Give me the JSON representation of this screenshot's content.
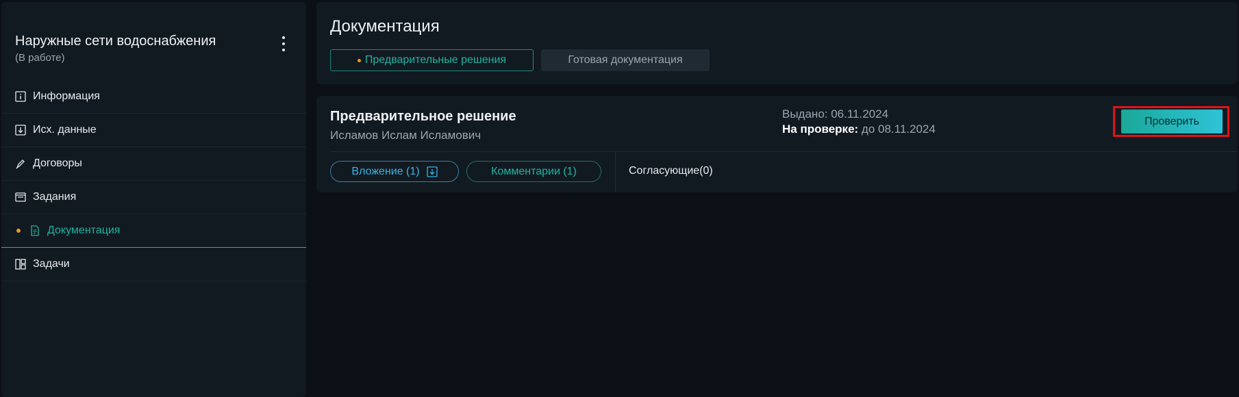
{
  "sidebar": {
    "project_title": "Наружные сети водоснабжения",
    "project_status": "(В работе)",
    "items": [
      {
        "label": "Информация",
        "icon": "info-icon"
      },
      {
        "label": "Исх. данные",
        "icon": "download-icon"
      },
      {
        "label": "Договоры",
        "icon": "pen-icon"
      },
      {
        "label": "Задания",
        "icon": "window-icon"
      },
      {
        "label": "Документация",
        "icon": "document-icon",
        "active": true
      },
      {
        "label": "Задачи",
        "icon": "layout-icon"
      }
    ]
  },
  "header": {
    "title": "Документация",
    "tabs": [
      {
        "label": "Предварительные решения",
        "active": true
      },
      {
        "label": "Готовая документация",
        "active": false
      }
    ]
  },
  "doc": {
    "title": "Предварительное решение",
    "author": "Исламов Ислам Исламович",
    "issued": "Выдано: 06.11.2024",
    "review_label": "На проверке:",
    "review_value": " до 08.11.2024",
    "check_button": "Проверить",
    "attachments": "Вложение (1)",
    "comments": "Комментарии (1)",
    "approvers": "Согласующие(0)"
  },
  "colors": {
    "accent": "#21b3a0",
    "warning_dot": "#e39b2c",
    "highlight_frame": "#e0121a",
    "attach_blue": "#3ab5e6"
  }
}
